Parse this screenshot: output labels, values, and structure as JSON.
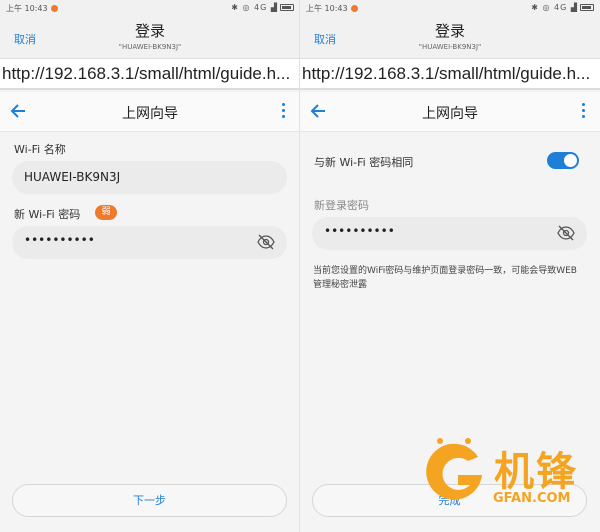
{
  "left": {
    "status": {
      "time": "上午 10:43",
      "signal": "4G"
    },
    "dialog": {
      "cancel": "取消",
      "title": "登录",
      "subtitle": "\"HUAWEI-BK9N3J\""
    },
    "url": "http://192.168.3.1/small/html/guide.h...",
    "appbar": {
      "title": "上网向导"
    },
    "wifi_name_label": "Wi-Fi 名称",
    "wifi_name_value": "HUAWEI-BK9N3J",
    "wifi_password_label": "新 Wi-Fi 密码",
    "strength_badge": "弱",
    "wifi_password_value": "••••••••••",
    "next_button": "下一步"
  },
  "right": {
    "status": {
      "time": "上午 10:43",
      "signal": "4G"
    },
    "dialog": {
      "cancel": "取消",
      "title": "登录",
      "subtitle": "\"HUAWEI-BK9N3J\""
    },
    "url": "http://192.168.3.1/small/html/guide.h...",
    "appbar": {
      "title": "上网向导"
    },
    "same_as_wifi_label": "与新 Wi-Fi 密码相同",
    "same_as_wifi_enabled": true,
    "login_password_label": "新登录密码",
    "login_password_value": "••••••••••",
    "warning_note": "当前您设置的WiFi密码与维护页面登录密码一致，可能会导致WEB管理秘密泄露",
    "finish_button": "完成"
  },
  "watermark": {
    "cn": "机锋",
    "en": "GFAN.COM"
  },
  "colors": {
    "accent": "#1f7fd6",
    "badge": "#f07a2b",
    "watermark": "#f5a421"
  },
  "icons": [
    "back-arrow-icon",
    "more-vert-icon",
    "eye-off-icon",
    "bluetooth-icon",
    "wifi-icon",
    "battery-icon"
  ]
}
